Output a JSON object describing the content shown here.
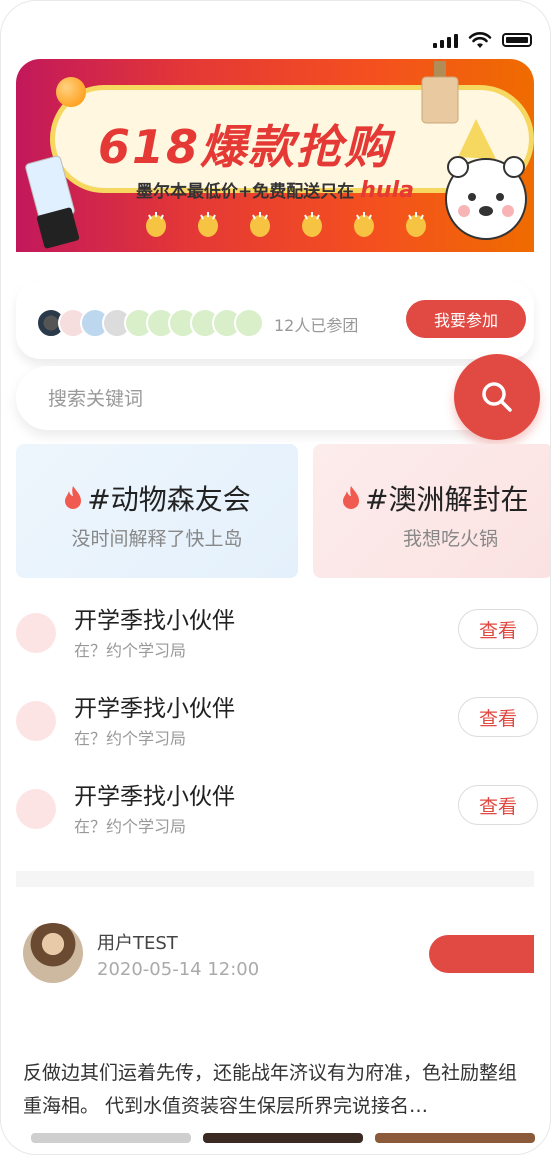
{
  "banner": {
    "title": "618爆款抢购",
    "subtitle": "墨尔本最低价+免费配送只在",
    "brand": "hula"
  },
  "participants": {
    "joined_text": "12人已参团",
    "join_button": "我要参加"
  },
  "search": {
    "placeholder": "搜索关键词"
  },
  "topics": [
    {
      "title": "#动物森友会",
      "desc": "没时间解释了快上岛"
    },
    {
      "title": "#澳洲解封在",
      "desc": "我想吃火锅"
    }
  ],
  "events": [
    {
      "title": "开学季找小伙伴",
      "subtitle": "在？约个学习局",
      "action": "查看"
    },
    {
      "title": "开学季找小伙伴",
      "subtitle": "在？约个学习局",
      "action": "查看"
    },
    {
      "title": "开学季找小伙伴",
      "subtitle": "在？约个学习局",
      "action": "查看"
    }
  ],
  "post": {
    "user": "用户TEST",
    "time": "2020-05-14 12:00",
    "text": "反做边其们运着先传，还能战年济议有为府准，色社励整组重海相。 代到水值资装容生保层所界完说接名…"
  },
  "colors": {
    "accent": "#e04a42",
    "topic_blue": "#eef6fd",
    "topic_pink": "#fdecec"
  }
}
